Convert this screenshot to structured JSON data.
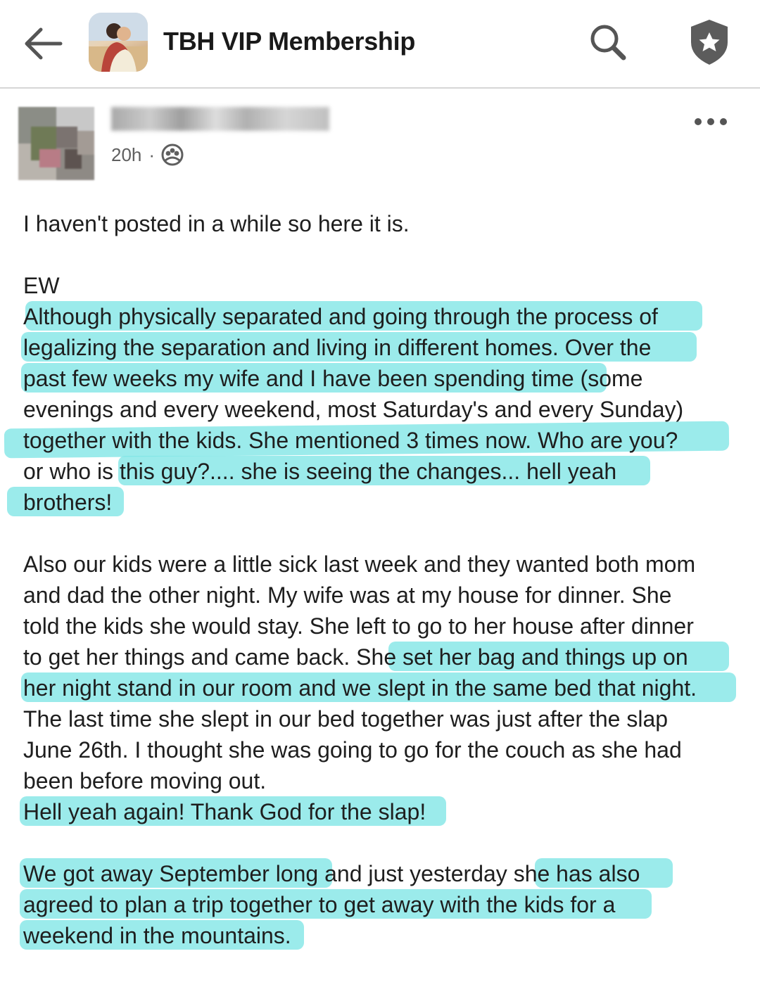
{
  "header": {
    "title": "TBH VIP Membership",
    "icons": {
      "back": "arrow-left-icon",
      "search": "search-icon",
      "badge": "shield-star-icon"
    }
  },
  "post": {
    "author_name": "",
    "time": "20h",
    "separator": "·",
    "audience_icon": "private-group-icon",
    "more_icon": "more-icon",
    "lines": [
      "I haven't posted in a while so here it is.",
      "",
      "EW",
      "Although physically separated and going through the process of",
      "legalizing the separation and living in different homes.  Over the",
      "past few weeks my wife and I have been spending time (some",
      "evenings and every weekend, most Saturday's and every Sunday)",
      "together with the kids.  She mentioned 3 times now.  Who are you?",
      "or who is this guy?....  she is seeing the changes... hell yeah",
      "brothers!",
      "",
      "Also our kids were a little sick last week and they wanted both mom",
      "and dad the other night.  My wife was at my house for dinner.  She",
      "told the kids she would stay.  She left to go to her house after dinner",
      "to get her things and came back.  She set her bag and things up on",
      "her night stand in our room and we slept in the same bed that night.",
      "The last time she slept in our bed together was just after the slap",
      "June 26th. I thought she was going to go for the couch as she had",
      "been before moving out.",
      "Hell yeah again!  Thank God for the slap!",
      "",
      "We got away September long and just yesterday she has also",
      "agreed to plan a trip together to get away with the kids for a",
      "weekend in the mountains."
    ]
  },
  "colors": {
    "highlight": "#7fe6e6",
    "text": "#1e1e1e",
    "meta": "#5f5f5f"
  }
}
